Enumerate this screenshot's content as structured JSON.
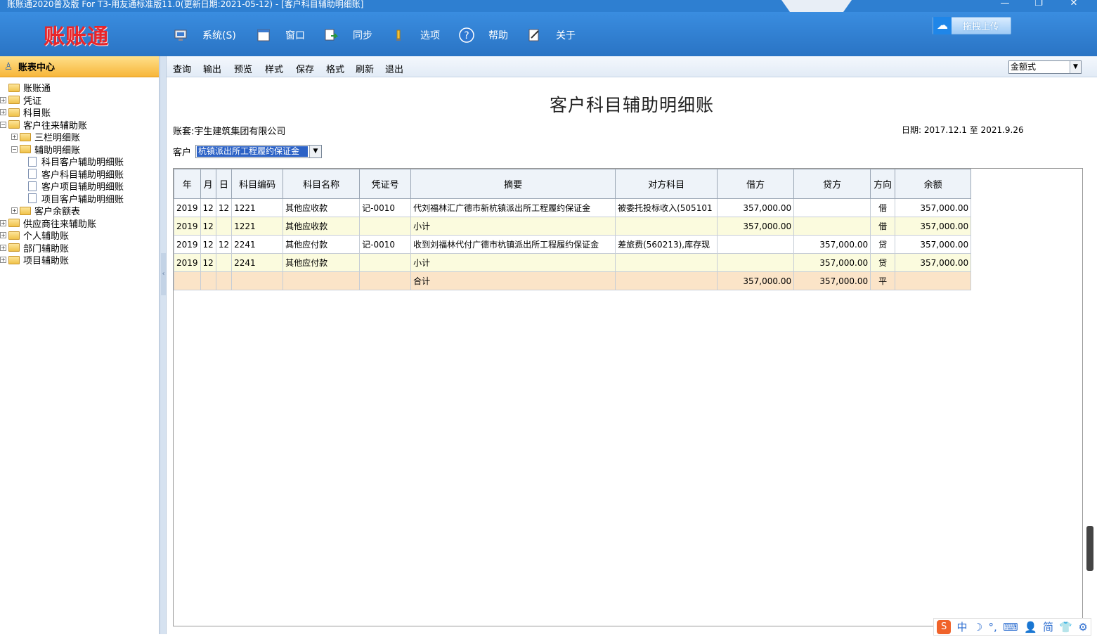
{
  "window": {
    "title": "账账通2020普及版 For T3-用友通标准版11.0(更新日期:2021-05-12) - [客户科目辅助明细账]",
    "minimize": "—",
    "maximize": "❐",
    "close": "✕"
  },
  "toolbar": {
    "logo": "账账通",
    "items": [
      {
        "label": "系统(S)",
        "icon": "system-icon"
      },
      {
        "label": "窗口",
        "icon": "window-icon"
      },
      {
        "label": "同步",
        "icon": "sync-icon"
      },
      {
        "label": "选项",
        "icon": "options-icon"
      },
      {
        "label": "帮助",
        "icon": "help-icon"
      },
      {
        "label": "关于",
        "icon": "about-icon"
      }
    ],
    "upload_label": "拖拽上传"
  },
  "sidebar": {
    "header": "账表中心",
    "tree": [
      {
        "label": "账账通",
        "level": 0,
        "type": "folder",
        "expander": ""
      },
      {
        "label": "凭证",
        "level": 0,
        "type": "folder",
        "expander": "+"
      },
      {
        "label": "科目账",
        "level": 0,
        "type": "folder",
        "expander": "+"
      },
      {
        "label": "客户往来辅助账",
        "level": 0,
        "type": "folder",
        "expander": "-"
      },
      {
        "label": "三栏明细账",
        "level": 1,
        "type": "folder",
        "expander": "+"
      },
      {
        "label": "辅助明细账",
        "level": 1,
        "type": "folder",
        "expander": "-"
      },
      {
        "label": "科目客户辅助明细账",
        "level": 2,
        "type": "doc",
        "expander": ""
      },
      {
        "label": "客户科目辅助明细账",
        "level": 2,
        "type": "doc",
        "expander": ""
      },
      {
        "label": "客户项目辅助明细账",
        "level": 2,
        "type": "doc",
        "expander": ""
      },
      {
        "label": "项目客户辅助明细账",
        "level": 2,
        "type": "doc",
        "expander": ""
      },
      {
        "label": "客户余额表",
        "level": 1,
        "type": "folder",
        "expander": "+"
      },
      {
        "label": "供应商往来辅助账",
        "level": 0,
        "type": "folder",
        "expander": "+"
      },
      {
        "label": "个人辅助账",
        "level": 0,
        "type": "folder",
        "expander": "+"
      },
      {
        "label": "部门辅助账",
        "level": 0,
        "type": "folder",
        "expander": "+"
      },
      {
        "label": "项目辅助账",
        "level": 0,
        "type": "folder",
        "expander": "+"
      }
    ]
  },
  "menu": {
    "items": [
      "查询",
      "输出",
      "预览",
      "样式",
      "保存",
      "格式",
      "刷新",
      "退出"
    ],
    "format_value": "金额式"
  },
  "report": {
    "title": "客户科目辅助明细账",
    "account": "账套:宇生建筑集团有限公司",
    "date": "日期: 2017.12.1 至 2021.9.26",
    "customer_label": "客户",
    "customer_value": "杭镇派出所工程履约保证金"
  },
  "grid": {
    "columns": [
      "年",
      "月",
      "日",
      "科目编码",
      "科目名称",
      "凭证号",
      "摘要",
      "对方科目",
      "借方",
      "贷方",
      "方向",
      "余额"
    ],
    "rows": [
      {
        "kind": "detail",
        "cells": [
          "2019",
          "12",
          "12",
          "1221",
          "其他应收款",
          "记-0010",
          "代刘福林汇广德市新杭镇派出所工程履约保证金",
          "被委托投标收入(505101",
          "357,000.00",
          "",
          "借",
          "357,000.00"
        ]
      },
      {
        "kind": "subtotal",
        "cells": [
          "2019",
          "12",
          "",
          "1221",
          "其他应收款",
          "",
          "小计",
          "",
          "357,000.00",
          "",
          "借",
          "357,000.00"
        ]
      },
      {
        "kind": "detail",
        "cells": [
          "2019",
          "12",
          "12",
          "2241",
          "其他应付款",
          "记-0010",
          "收到刘福林代付广德市杭镇派出所工程履约保证金",
          "差旅费(560213),库存现",
          "",
          "357,000.00",
          "贷",
          "357,000.00"
        ]
      },
      {
        "kind": "subtotal",
        "cells": [
          "2019",
          "12",
          "",
          "2241",
          "其他应付款",
          "",
          "小计",
          "",
          "",
          "357,000.00",
          "贷",
          "357,000.00"
        ]
      },
      {
        "kind": "total",
        "cells": [
          "",
          "",
          "",
          "",
          "",
          "",
          "合计",
          "",
          "357,000.00",
          "357,000.00",
          "平",
          ""
        ]
      }
    ]
  },
  "ime": {
    "logo": "S",
    "items": [
      "中",
      "☽",
      "°,",
      "⌨",
      "👤",
      "简",
      "👕",
      "⚙"
    ]
  }
}
